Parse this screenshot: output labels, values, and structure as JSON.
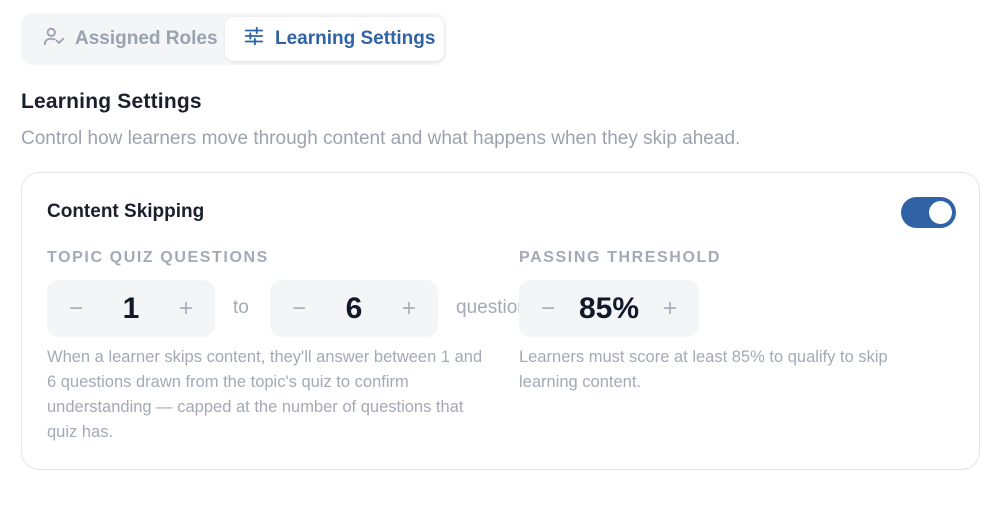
{
  "tabs": [
    {
      "label": "Assigned Roles",
      "icon": "user-check-icon",
      "active": false
    },
    {
      "label": "Learning Settings",
      "icon": "sliders-icon",
      "active": true
    }
  ],
  "section": {
    "title": "Learning Settings",
    "description": "Control how learners move through content and what happens when they skip ahead."
  },
  "card": {
    "title": "Content Skipping",
    "toggle_on": true,
    "quiz": {
      "label": "TOPIC QUIZ QUESTIONS",
      "min": "1",
      "max": "6",
      "to_text": "to",
      "unit_text": "questions",
      "help": "When a learner skips content, they'll answer between 1 and 6 questions drawn from the topic's quiz to confirm understanding — capped at the number of questions that quiz has."
    },
    "threshold": {
      "label": "PASSING THRESHOLD",
      "value": "85%",
      "help": "Learners must score at least 85% to qualify to skip learning content."
    },
    "stepper": {
      "minus": "−",
      "plus": "+"
    }
  },
  "colors": {
    "accent": "#2f63a6",
    "muted": "#a3aab5",
    "stepper_bg": "#f3f5f7"
  }
}
